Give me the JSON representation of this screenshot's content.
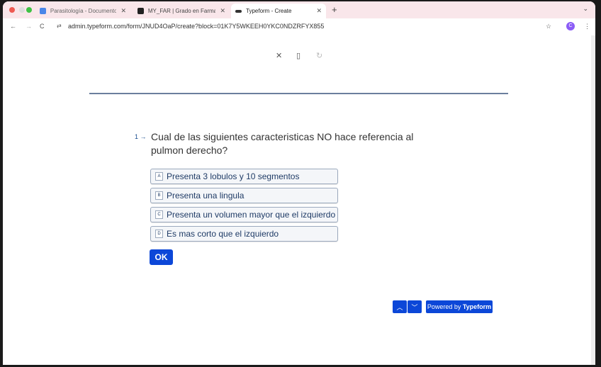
{
  "browser": {
    "tabs": [
      {
        "label": "Parasitología - Documentos"
      },
      {
        "label": "MY_FAR | Grado en Farmacia"
      },
      {
        "label": "Typeform - Create"
      }
    ],
    "url": "admin.typeform.com/form/JNUD4OaP/create?block=01K7Y5WKEEH0YKC0NDZRFYX855",
    "avatar": "C"
  },
  "question": {
    "number": "1",
    "text": "Cual de las siguientes caracteristicas NO hace referencia al pulmon derecho?",
    "options": [
      {
        "key": "A",
        "label": "Presenta 3 lobulos y 10 segmentos"
      },
      {
        "key": "B",
        "label": "Presenta una lingula"
      },
      {
        "key": "C",
        "label": "Presenta un volumen mayor que el izquierdo"
      },
      {
        "key": "D",
        "label": "Es mas corto que el izquierdo"
      }
    ]
  },
  "ok_label": "OK",
  "powered": {
    "prefix": "Powered by ",
    "brand": "Typeform"
  },
  "colors": {
    "accent": "#0c47d8",
    "text": "#1f3b66"
  }
}
